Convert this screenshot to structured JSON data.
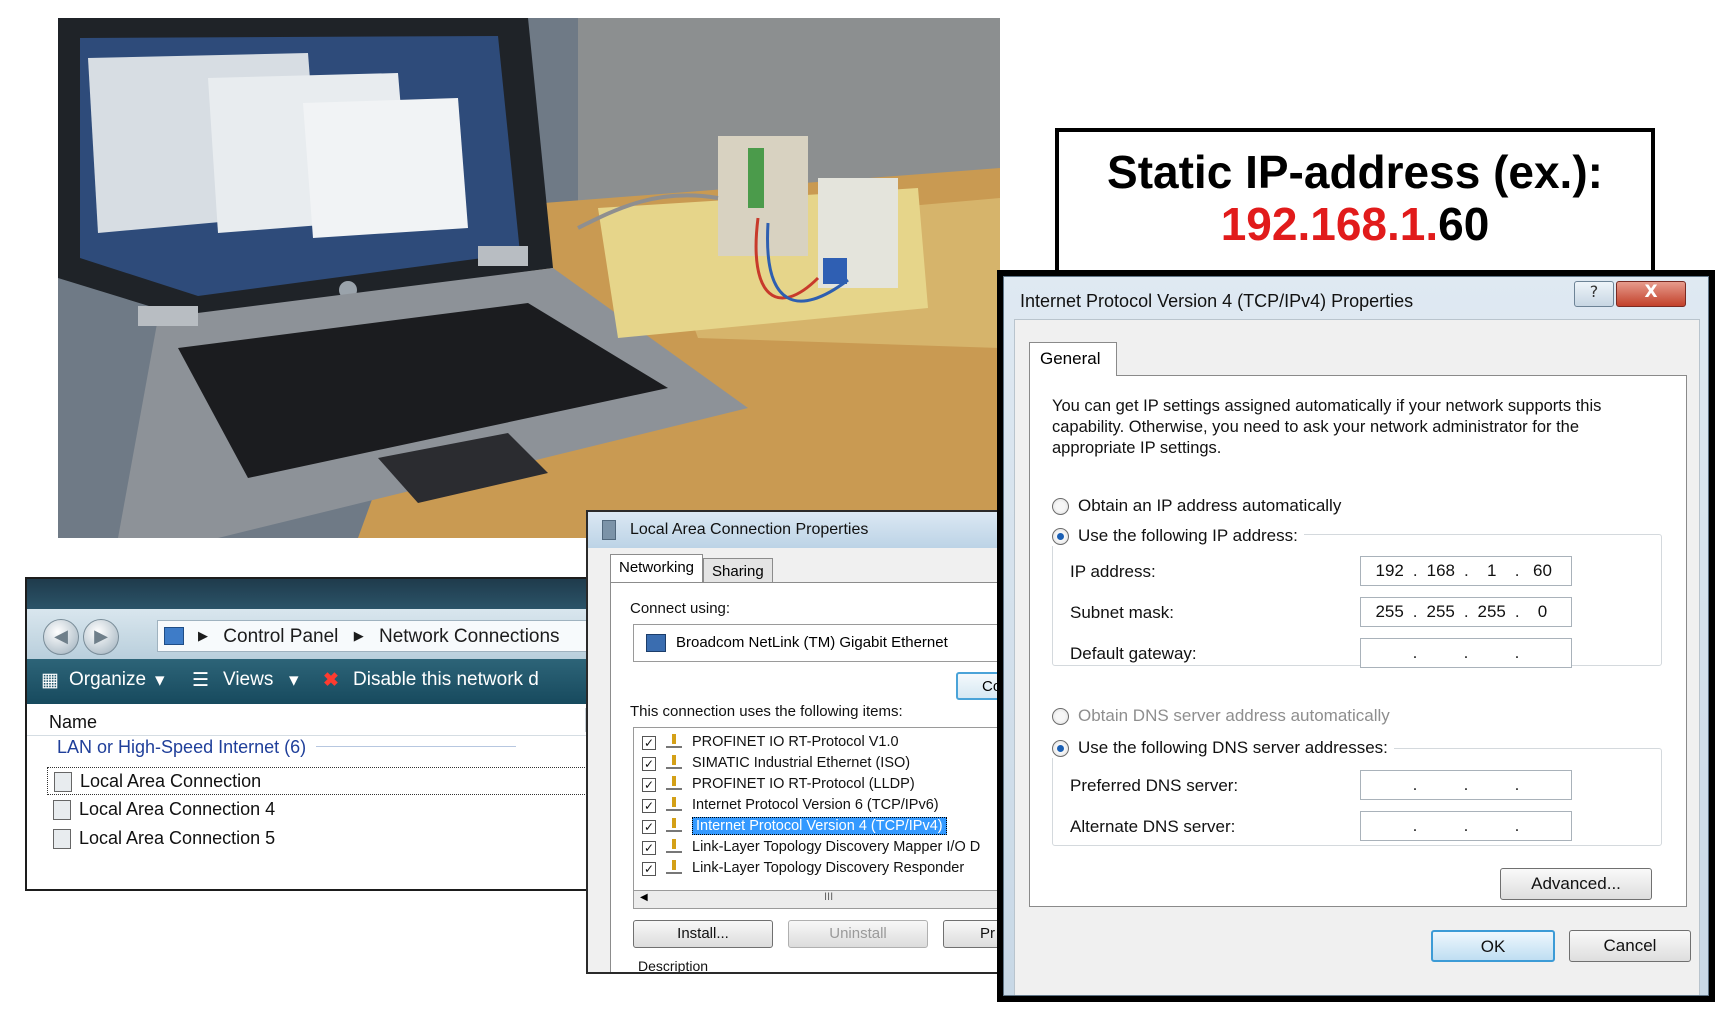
{
  "callout": {
    "line1": "Static IP-address (ex.):",
    "ip_red": "192.168.1.",
    "ip_black": "60",
    "accent_color": "#e11b1b"
  },
  "explorer": {
    "breadcrumb": [
      "Control Panel",
      "Network Connections"
    ],
    "toolbar": {
      "organize": "Organize",
      "views": "Views",
      "disable": "Disable this network d"
    },
    "column_name": "Name",
    "group_label": "LAN or High-Speed Internet (6)",
    "rows": [
      "Local Area Connection",
      "Local Area Connection 4",
      "Local Area Connection 5"
    ]
  },
  "lan_properties": {
    "title": "Local Area Connection Properties",
    "tabs": [
      "Networking",
      "Sharing"
    ],
    "connect_using_label": "Connect using:",
    "adapter": "Broadcom NetLink (TM) Gigabit Ethernet",
    "configure_button": "Co",
    "items_label": "This connection uses the following items:",
    "items": [
      {
        "label": "PROFINET IO RT-Protocol V1.0",
        "checked": true
      },
      {
        "label": "SIMATIC Industrial Ethernet (ISO)",
        "checked": true
      },
      {
        "label": "PROFINET IO RT-Protocol (LLDP)",
        "checked": true
      },
      {
        "label": "Internet Protocol Version 6 (TCP/IPv6)",
        "checked": true
      },
      {
        "label": "Internet Protocol Version 4 (TCP/IPv4)",
        "checked": true,
        "selected": true
      },
      {
        "label": "Link-Layer Topology Discovery Mapper I/O D",
        "checked": true
      },
      {
        "label": "Link-Layer Topology Discovery Responder",
        "checked": true
      }
    ],
    "scroll_mark": "III",
    "buttons": {
      "install": "Install...",
      "uninstall": "Uninstall",
      "properties": "Pr"
    },
    "description_label": "Description"
  },
  "ipv4_dialog": {
    "title": "Internet Protocol Version 4 (TCP/IPv4) Properties",
    "help_glyph": "?",
    "close_glyph": "X",
    "tab": "General",
    "intro": "You can get IP settings assigned automatically if your network supports this capability. Otherwise, you need to ask your network administrator for the appropriate IP settings.",
    "radio_auto_ip": "Obtain an IP address automatically",
    "radio_static_ip": "Use the following IP address:",
    "ip_label": "IP address:",
    "ip_value": [
      "192",
      "168",
      "1",
      "60"
    ],
    "subnet_label": "Subnet mask:",
    "subnet_value": [
      "255",
      "255",
      "255",
      "0"
    ],
    "gateway_label": "Default gateway:",
    "radio_auto_dns": "Obtain DNS server address automatically",
    "radio_static_dns": "Use the following DNS server addresses:",
    "preferred_dns_label": "Preferred DNS server:",
    "alternate_dns_label": "Alternate DNS server:",
    "advanced_button": "Advanced...",
    "ok_button": "OK",
    "cancel_button": "Cancel"
  }
}
